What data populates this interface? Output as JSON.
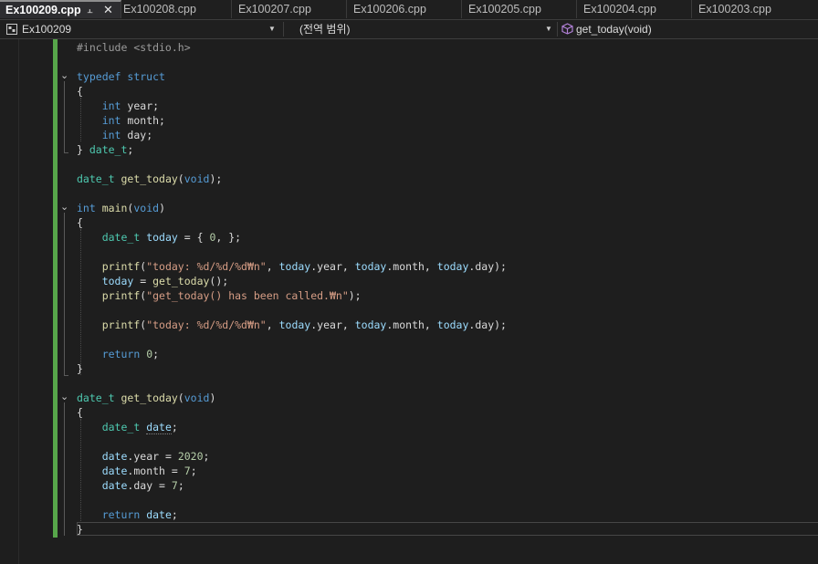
{
  "tabs": [
    {
      "label": "Ex100209.cpp",
      "active": true
    },
    {
      "label": "Ex100208.cpp",
      "active": false
    },
    {
      "label": "Ex100207.cpp",
      "active": false
    },
    {
      "label": "Ex100206.cpp",
      "active": false
    },
    {
      "label": "Ex100205.cpp",
      "active": false
    },
    {
      "label": "Ex100204.cpp",
      "active": false
    },
    {
      "label": "Ex100203.cpp",
      "active": false
    }
  ],
  "nav": {
    "project": "Ex100209",
    "scope": "(전역 범위)",
    "member": "get_today(void)"
  },
  "icons": {
    "pin": "pin-icon",
    "close": "close-icon",
    "project": "project-icon",
    "member": "method-cube-icon",
    "dropdown": "chevron-down-icon",
    "fold": "fold-collapse-icon"
  },
  "colors": {
    "accent_change_bar": "#57a64a",
    "keyword": "#569cd6",
    "type": "#4ec9b0",
    "function": "#dcdcaa",
    "variable": "#9cdcfe",
    "string": "#d69d85",
    "number": "#b5cea8"
  },
  "code": {
    "lines": [
      [
        [
          "pp",
          "#include "
        ],
        [
          "pp",
          "<stdio.h>"
        ]
      ],
      [],
      [
        [
          "kw",
          "typedef"
        ],
        [
          "op",
          " "
        ],
        [
          "kw",
          "struct"
        ]
      ],
      [
        [
          "op",
          "{"
        ]
      ],
      [
        [
          "op",
          "    "
        ],
        [
          "kw",
          "int"
        ],
        [
          "op",
          " "
        ],
        [
          "fd",
          "year"
        ],
        [
          "op",
          ";"
        ]
      ],
      [
        [
          "op",
          "    "
        ],
        [
          "kw",
          "int"
        ],
        [
          "op",
          " "
        ],
        [
          "fd",
          "month"
        ],
        [
          "op",
          ";"
        ]
      ],
      [
        [
          "op",
          "    "
        ],
        [
          "kw",
          "int"
        ],
        [
          "op",
          " "
        ],
        [
          "fd",
          "day"
        ],
        [
          "op",
          ";"
        ]
      ],
      [
        [
          "op",
          "} "
        ],
        [
          "ty",
          "date_t"
        ],
        [
          "op",
          ";"
        ]
      ],
      [],
      [
        [
          "ty",
          "date_t"
        ],
        [
          "op",
          " "
        ],
        [
          "fn",
          "get_today"
        ],
        [
          "op",
          "("
        ],
        [
          "kw",
          "void"
        ],
        [
          "op",
          ");"
        ]
      ],
      [],
      [
        [
          "kw",
          "int"
        ],
        [
          "op",
          " "
        ],
        [
          "fn",
          "main"
        ],
        [
          "op",
          "("
        ],
        [
          "kw",
          "void"
        ],
        [
          "op",
          ")"
        ]
      ],
      [
        [
          "op",
          "{"
        ]
      ],
      [
        [
          "op",
          "    "
        ],
        [
          "ty",
          "date_t"
        ],
        [
          "op",
          " "
        ],
        [
          "vr",
          "today"
        ],
        [
          "op",
          " = { "
        ],
        [
          "nu",
          "0"
        ],
        [
          "op",
          ", };"
        ]
      ],
      [],
      [
        [
          "op",
          "    "
        ],
        [
          "fn",
          "printf"
        ],
        [
          "op",
          "("
        ],
        [
          "st",
          "\"today: %d/%d/%d₩n\""
        ],
        [
          "op",
          ", "
        ],
        [
          "vr",
          "today"
        ],
        [
          "op",
          "."
        ],
        [
          "fd",
          "year"
        ],
        [
          "op",
          ", "
        ],
        [
          "vr",
          "today"
        ],
        [
          "op",
          "."
        ],
        [
          "fd",
          "month"
        ],
        [
          "op",
          ", "
        ],
        [
          "vr",
          "today"
        ],
        [
          "op",
          "."
        ],
        [
          "fd",
          "day"
        ],
        [
          "op",
          ");"
        ]
      ],
      [
        [
          "op",
          "    "
        ],
        [
          "vr",
          "today"
        ],
        [
          "op",
          " = "
        ],
        [
          "fn",
          "get_today"
        ],
        [
          "op",
          "();"
        ]
      ],
      [
        [
          "op",
          "    "
        ],
        [
          "fn",
          "printf"
        ],
        [
          "op",
          "("
        ],
        [
          "st",
          "\"get_today() has been called.₩n\""
        ],
        [
          "op",
          ");"
        ]
      ],
      [],
      [
        [
          "op",
          "    "
        ],
        [
          "fn",
          "printf"
        ],
        [
          "op",
          "("
        ],
        [
          "st",
          "\"today: %d/%d/%d₩n\""
        ],
        [
          "op",
          ", "
        ],
        [
          "vr",
          "today"
        ],
        [
          "op",
          "."
        ],
        [
          "fd",
          "year"
        ],
        [
          "op",
          ", "
        ],
        [
          "vr",
          "today"
        ],
        [
          "op",
          "."
        ],
        [
          "fd",
          "month"
        ],
        [
          "op",
          ", "
        ],
        [
          "vr",
          "today"
        ],
        [
          "op",
          "."
        ],
        [
          "fd",
          "day"
        ],
        [
          "op",
          ");"
        ]
      ],
      [],
      [
        [
          "op",
          "    "
        ],
        [
          "kw",
          "return"
        ],
        [
          "op",
          " "
        ],
        [
          "nu",
          "0"
        ],
        [
          "op",
          ";"
        ]
      ],
      [
        [
          "op",
          "}"
        ]
      ],
      [],
      [
        [
          "ty",
          "date_t"
        ],
        [
          "op",
          " "
        ],
        [
          "fn",
          "get_today"
        ],
        [
          "op",
          "("
        ],
        [
          "kw",
          "void"
        ],
        [
          "op",
          ")"
        ]
      ],
      [
        [
          "op",
          "{"
        ]
      ],
      [
        [
          "op",
          "    "
        ],
        [
          "ty",
          "date_t"
        ],
        [
          "op",
          " "
        ],
        [
          "vr squig",
          "date"
        ],
        [
          "op",
          ";"
        ]
      ],
      [],
      [
        [
          "op",
          "    "
        ],
        [
          "vr",
          "date"
        ],
        [
          "op",
          "."
        ],
        [
          "fd",
          "year"
        ],
        [
          "op",
          " = "
        ],
        [
          "nu",
          "2020"
        ],
        [
          "op",
          ";"
        ]
      ],
      [
        [
          "op",
          "    "
        ],
        [
          "vr",
          "date"
        ],
        [
          "op",
          "."
        ],
        [
          "fd",
          "month"
        ],
        [
          "op",
          " = "
        ],
        [
          "nu",
          "7"
        ],
        [
          "op",
          ";"
        ]
      ],
      [
        [
          "op",
          "    "
        ],
        [
          "vr",
          "date"
        ],
        [
          "op",
          "."
        ],
        [
          "fd",
          "day"
        ],
        [
          "op",
          " = "
        ],
        [
          "nu",
          "7"
        ],
        [
          "op",
          ";"
        ]
      ],
      [],
      [
        [
          "op",
          "    "
        ],
        [
          "kw",
          "return"
        ],
        [
          "op",
          " "
        ],
        [
          "vr",
          "date"
        ],
        [
          "op",
          ";"
        ]
      ],
      [
        [
          "op",
          "}"
        ]
      ]
    ]
  }
}
